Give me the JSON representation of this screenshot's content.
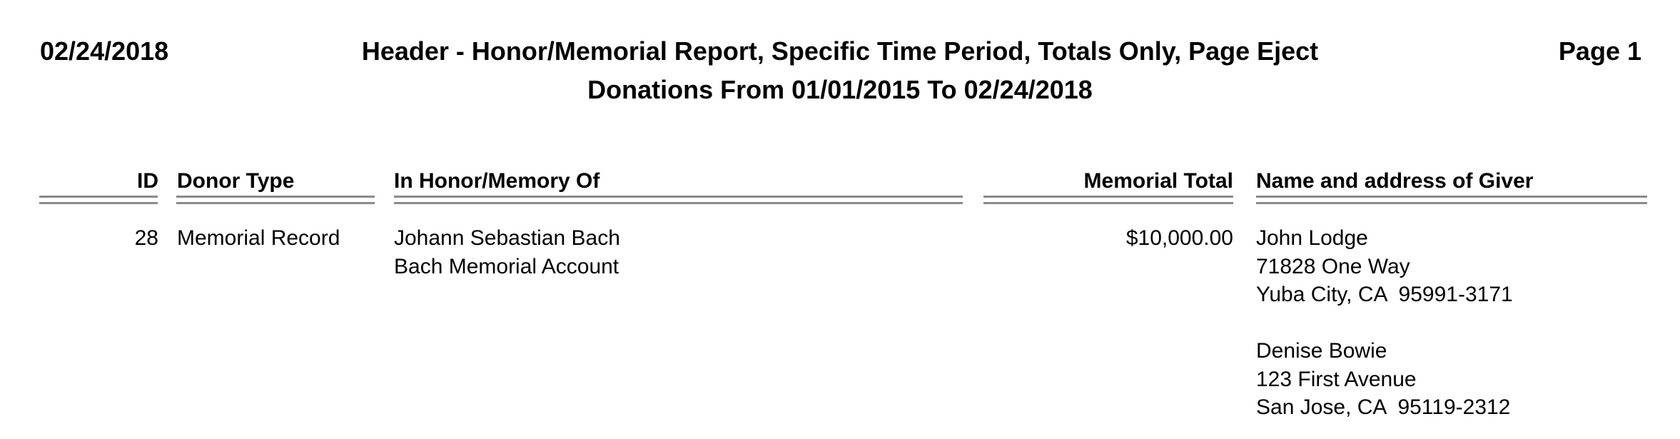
{
  "header": {
    "date": "02/24/2018",
    "title": "Header - Honor/Memorial Report, Specific Time Period, Totals Only, Page Eject",
    "subtitle": "Donations From 01/01/2015 To 02/24/2018",
    "page_label": "Page 1"
  },
  "columns": {
    "id": "ID",
    "donor_type": "Donor Type",
    "honor_memory_of": "In Honor/Memory Of",
    "memorial_total": "Memorial Total",
    "giver": "Name and address of Giver"
  },
  "rows": [
    {
      "id": "28",
      "donor_type": "Memorial Record",
      "honor_memory_of": [
        "Johann Sebastian Bach",
        "Bach Memorial Account"
      ],
      "memorial_total": "$10,000.00",
      "givers": [
        {
          "name": "John Lodge",
          "street": "71828 One Way",
          "city_state_zip": "Yuba City, CA  95991-3171"
        },
        {
          "name": "Denise Bowie",
          "street": "123 First Avenue",
          "city_state_zip": "San Jose, CA  95119-2312"
        }
      ]
    }
  ]
}
